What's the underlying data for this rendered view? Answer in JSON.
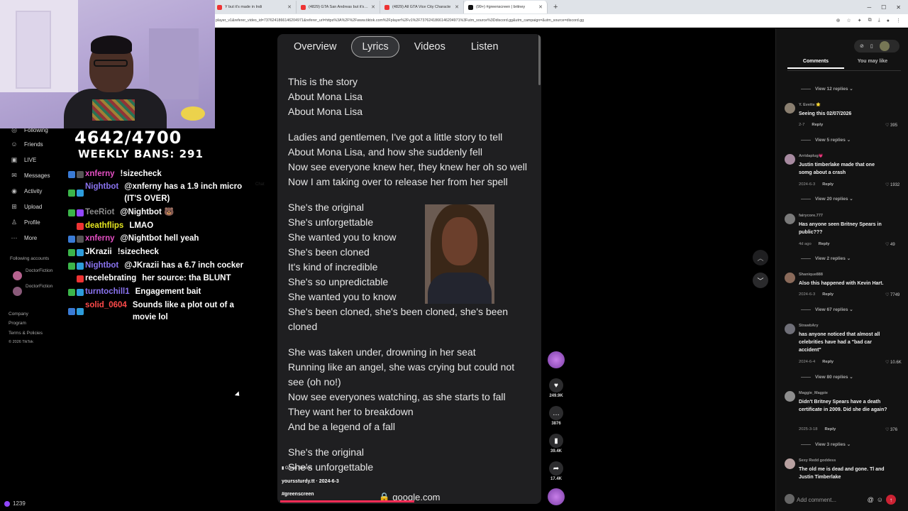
{
  "browser": {
    "tabs": [
      {
        "title": "Y but it's made in Indi"
      },
      {
        "title": "(4829) GTA San Andreas but it's L!"
      },
      {
        "title": "(4829) All GTA Vice City Characte"
      },
      {
        "title": "(99+) #greenscreen | britney"
      }
    ],
    "new_tab": "+",
    "url": "player_v1&referer_video_id=7376241866146204971&referer_url=https%3A%2F%2Fwww.tiktok.com%2Fplayer%2Fv1%2F7376241866146204971%3Futm_source%3Ddiscord.gg&utm_campaign=&utm_source=discord.gg",
    "chat_label": "Chat"
  },
  "overlay": {
    "counter": "4642/4700",
    "weekly_bans": "WEEKLY BANS: 291"
  },
  "tiktok_nav": {
    "items": [
      "Following",
      "Friends",
      "LIVE",
      "Messages",
      "Activity",
      "Upload",
      "Profile",
      "More"
    ],
    "following_accounts": "Following accounts",
    "accounts": [
      "DoctorFiction",
      "DoctorFiction"
    ],
    "footer": [
      "Company",
      "Program",
      "Terms & Policies",
      "© 2026 TikTok"
    ]
  },
  "chat": {
    "messages": [
      {
        "user": "xnferny",
        "color": "#e54fc4",
        "text": "!sizecheck"
      },
      {
        "user": "Nightbot",
        "color": "#8a73f0",
        "text": "@xnferny has a 1.9 inch micro (IT'S OVER)"
      },
      {
        "user": "TeeRiot",
        "color": "#8c8c8c",
        "text": "@Nightbot 🐻"
      },
      {
        "user": "deathflips",
        "color": "#e5e620",
        "text": "LMAO"
      },
      {
        "user": "xnferny",
        "color": "#e54fc4",
        "text": "@Nightbot hell yeah"
      },
      {
        "user": "JKrazii",
        "color": "#ffffff",
        "text": "!sizecheck"
      },
      {
        "user": "Nightbot",
        "color": "#8a73f0",
        "text": "@JKrazii has a 6.7 inch cocker"
      },
      {
        "user": "recelebrating",
        "color": "#ffffff",
        "text": "her source: tha BLUNT"
      },
      {
        "user": "turntochill1",
        "color": "#8a73f0",
        "text": "Engagement bait"
      },
      {
        "user": "solid_0604",
        "color": "#ff4a4a",
        "text": "Sounds like a plot out of a movie lol"
      }
    ],
    "viewer_count": "1239"
  },
  "video": {
    "tabs": [
      "Overview",
      "Lyrics",
      "Videos",
      "Listen"
    ],
    "selected_tab": "Lyrics",
    "lyrics": [
      [
        "This is the story",
        "About Mona Lisa",
        "About Mona Lisa"
      ],
      [
        "Ladies and gentlemen, I've got a little story to tell",
        "About Mona Lisa, and how she suddenly fell",
        "Now see everyone knew her, they knew her oh so well",
        "Now I am taking over to release her from her spell"
      ],
      [
        "She's the original",
        "She's unforgettable",
        "She wanted you to know",
        "She's been cloned",
        "It's kind of incredible",
        "She's so unpredictable",
        "She wanted you to know",
        "She's been cloned, she's been cloned, she's been cloned"
      ],
      [
        "She was taken under, drowning in her seat",
        "Running like an angel, she was crying but could not see (oh no!)",
        "Now see everyones watching, as she starts to fall",
        "They want her to breakdown",
        "And be a legend of a fall"
      ],
      [
        "She's the original",
        "She's unforgettable"
      ]
    ],
    "caption_badge": "Green Screen",
    "author": "yourssturdy.tt · 2024-6-3",
    "hashtag": "#greenscreen",
    "domain": "google.com",
    "progress": 0.52
  },
  "actions": {
    "likes": "249.9K",
    "comments": "3876",
    "saves": "39.4K",
    "shares": "17.4K"
  },
  "comments": {
    "tabs": [
      "Comments",
      "You may like"
    ],
    "items": [
      {
        "replies": "View 12 replies"
      },
      {
        "user": "Y. Evette 🌟",
        "text": "Seeing this 02/07/2026",
        "date": "2-7",
        "reply": "Reply",
        "likes": "395",
        "replies": "View 5 replies"
      },
      {
        "user": "Arridaplug💗",
        "text": "Justin timberlake made that one somg about a crash",
        "date": "2024-6-3",
        "reply": "Reply",
        "likes": "1932",
        "replies": "View 20 replies"
      },
      {
        "user": "fairycore.777",
        "text": "Has anyone seen Britney Spears in public???",
        "date": "4d ago",
        "reply": "Reply",
        "likes": "49",
        "replies": "View 2 replies"
      },
      {
        "user": "Shanique888",
        "text": "Also this happened with Kevin Hart.",
        "date": "2024-6-3",
        "reply": "Reply",
        "likes": "7749",
        "replies": "View 67 replies"
      },
      {
        "user": "StrawbAry",
        "text": "has anyone noticed that almost all celebrities have had a \"bad car accident\"",
        "date": "2024-6-4",
        "reply": "Reply",
        "likes": "10.6K",
        "replies": "View 80 replies"
      },
      {
        "user": "Maggie_Magpie",
        "text": "Didn't Britney Spears have a death certificate in 2009. Did she die again?",
        "date": "2025-3-18",
        "reply": "Reply",
        "likes": "376",
        "replies": "View 3 replies"
      },
      {
        "user": "Sexy Redd goddess",
        "text": "The old me is dead and gone. Tl and Justin Timberlake"
      }
    ],
    "add_placeholder": "Add comment..."
  }
}
